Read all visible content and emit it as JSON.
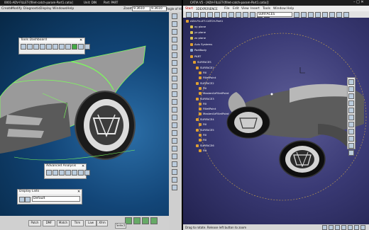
{
  "left_app": {
    "title": "0001-ADV-FILLET-[fillet-catch-param-Part1.catia]",
    "title_mid": "Unit: DIN",
    "title_right": "Part: PART",
    "menu": [
      "Create",
      "Modify",
      "Diagnostic",
      "Display",
      "Windows",
      "Help"
    ],
    "zoom_label": "Zoom",
    "zoom_value": "9.3610",
    "zoom_value2": "9.3610",
    "angle_label": "Angle of Hist",
    "tools_dashboard_title": "Tools Dashboard",
    "advanced_analysis_title": "Advanced Analysis",
    "display_lists_title": "Display Lists",
    "display_lists_value": "Default",
    "bottom_buttons": [
      "Patch",
      "DMF",
      "Match",
      "Trim",
      "Law",
      "Xfrm",
      "Curve",
      "Split"
    ],
    "select_button": "Select"
  },
  "right_app": {
    "title": "CATIA V5 - [ADV-FILLET-[fillet-catch-param-Part1.catia]]",
    "brand": "3DEXPERIENCE",
    "menu": [
      "Start",
      "ENOVIA",
      "File",
      "Edit",
      "View",
      "Insert",
      "Tools",
      "Window",
      "Help"
    ],
    "toolbar_field": "SURFACES",
    "tree": [
      {
        "label": "ADV-FILLET-CATCH-Part1",
        "kind": "root"
      },
      {
        "label": "xy plane",
        "kind": "plane"
      },
      {
        "label": "yz plane",
        "kind": "plane"
      },
      {
        "label": "zx plane",
        "kind": "plane"
      },
      {
        "label": "Axis Systems",
        "kind": "folder"
      },
      {
        "label": "PartBody",
        "kind": "body"
      },
      {
        "label": "PART",
        "kind": "folder"
      },
      {
        "label": "SURFACES",
        "kind": "folder"
      },
      {
        "label": "SURFACE1",
        "kind": "surf"
      },
      {
        "label": "Fill",
        "kind": "surf"
      },
      {
        "label": "FilletPoint",
        "kind": "surf"
      },
      {
        "label": "SURFACE2",
        "kind": "surf"
      },
      {
        "label": "Fill",
        "kind": "surf"
      },
      {
        "label": "MasterAirFilletPoint",
        "kind": "surf"
      },
      {
        "label": "SURFACE3",
        "kind": "surf"
      },
      {
        "label": "Fill",
        "kind": "surf"
      },
      {
        "label": "FilletPoint",
        "kind": "surf"
      },
      {
        "label": "MasterAirFilletPoint",
        "kind": "surf"
      },
      {
        "label": "SURFACE4",
        "kind": "surf"
      },
      {
        "label": "Fill",
        "kind": "surf"
      },
      {
        "label": "SURFACE5",
        "kind": "surf"
      },
      {
        "label": "Fill",
        "kind": "surf"
      },
      {
        "label": "Fill",
        "kind": "surf"
      },
      {
        "label": "SURFACE6",
        "kind": "surf"
      },
      {
        "label": "Fill",
        "kind": "surf"
      }
    ],
    "status": "Drag to rotate. Release left button to zoom"
  },
  "colors": {
    "left_bg": "#0c2f52",
    "right_bg": "#3a3a75",
    "tree_icon": "#e0a030",
    "highlight_green": "#7cff5a"
  }
}
